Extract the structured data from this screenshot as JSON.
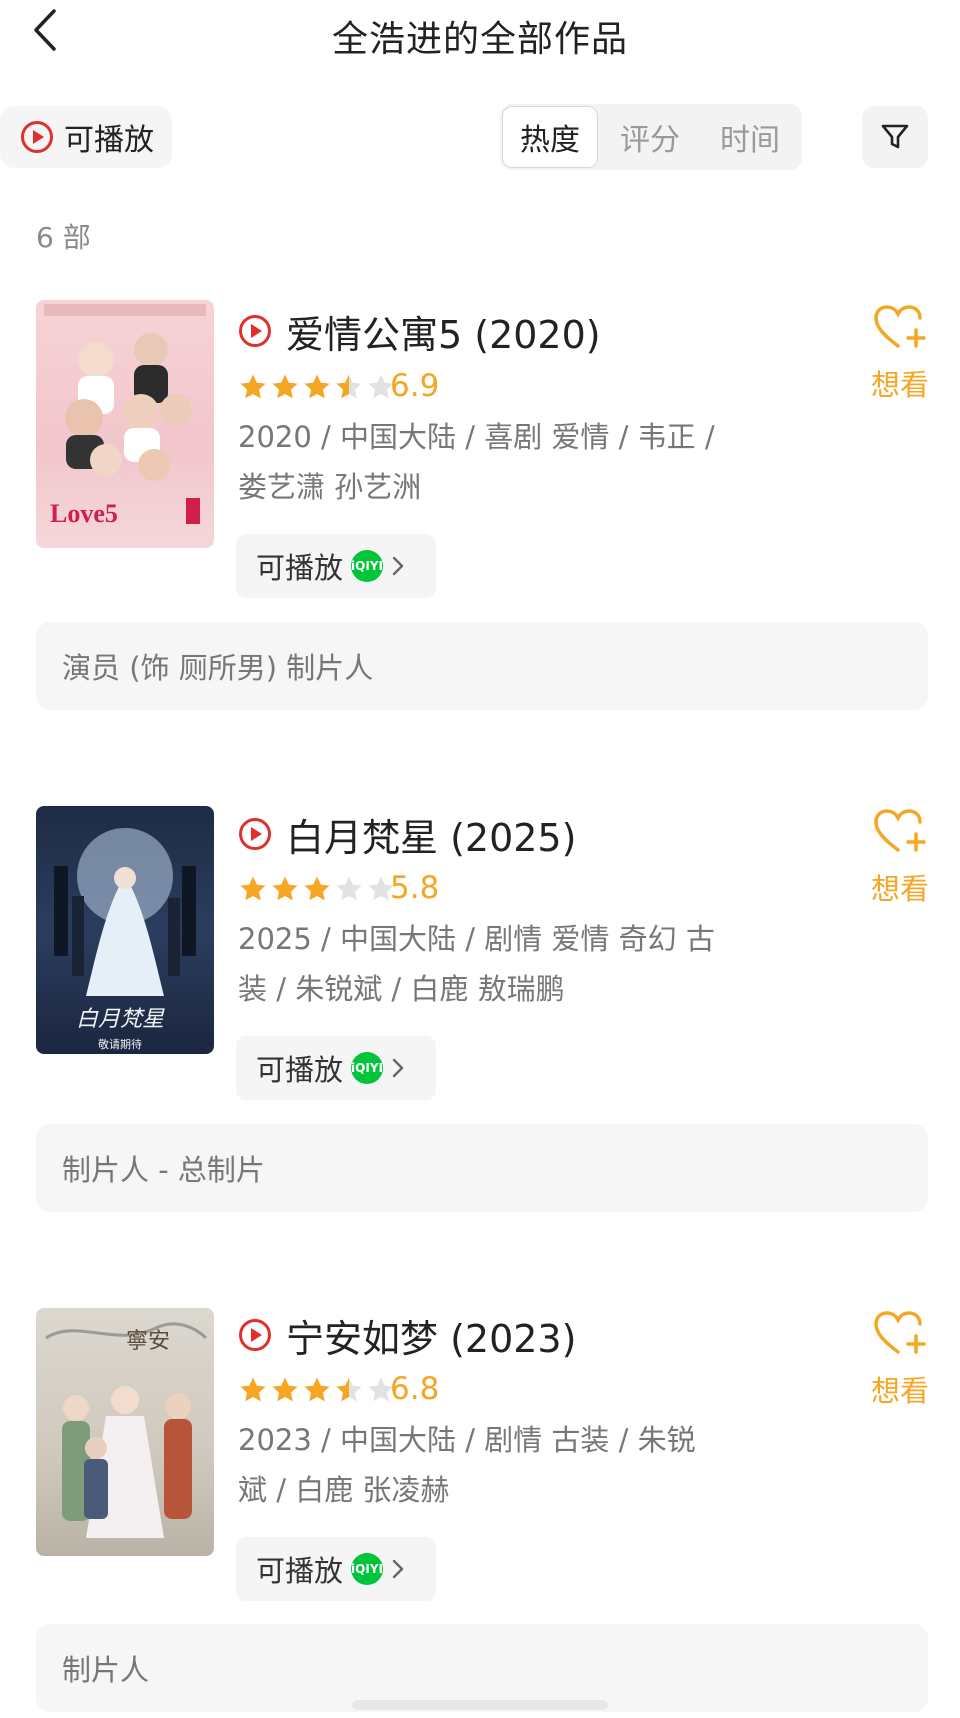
{
  "header": {
    "title": "全浩进的全部作品"
  },
  "filters": {
    "playable_label": "可播放",
    "sort_tabs": [
      "热度",
      "评分",
      "时间"
    ],
    "active_sort": "热度"
  },
  "count_text": "6 部",
  "colors": {
    "accent": "#f5a623",
    "play_red": "#e0302b",
    "iqiyi_green": "#00c53b"
  },
  "works": [
    {
      "title": "爱情公寓5 (2020)",
      "rating": "6.9",
      "rating_stars": 3.5,
      "meta_line1": "2020 / 中国大陆 / 喜剧 爱情 / 韦正 /",
      "meta_line2": "娄艺潇 孙艺洲",
      "play_label": "可播放",
      "platform_icon": "iqiyi-icon",
      "platform_text": "iQIYI",
      "wish_label": "想看",
      "role": "演员 (饰 厕所男)   制片人"
    },
    {
      "title": "白月梵星 (2025)",
      "rating": "5.8",
      "rating_stars": 3,
      "meta_line1": "2025 / 中国大陆 / 剧情 爱情 奇幻 古",
      "meta_line2": "装 / 朱锐斌 / 白鹿 敖瑞鹏",
      "play_label": "可播放",
      "platform_icon": "iqiyi-icon",
      "platform_text": "iQIYI",
      "wish_label": "想看",
      "role": "制片人 - 总制片"
    },
    {
      "title": "宁安如梦 (2023)",
      "rating": "6.8",
      "rating_stars": 3.5,
      "meta_line1": "2023 / 中国大陆 / 剧情 古装 / 朱锐",
      "meta_line2": "斌 / 白鹿 张凌赫",
      "play_label": "可播放",
      "platform_icon": "iqiyi-icon",
      "platform_text": "iQIYI",
      "wish_label": "想看",
      "role": "制片人"
    }
  ]
}
